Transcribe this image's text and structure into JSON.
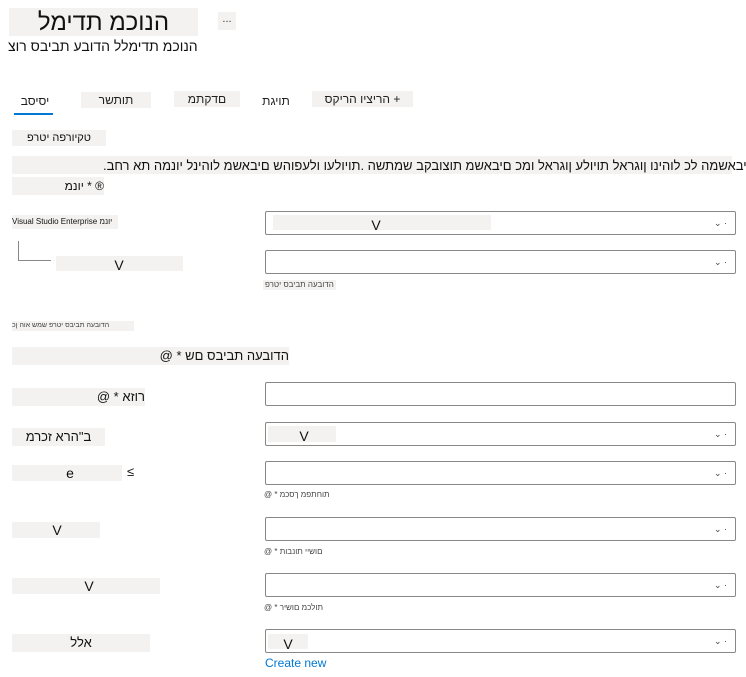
{
  "header": {
    "title": "הנוכמ תדימל",
    "more_label": "...",
    "subtitle": "הנוכמ תדימלל הדובע תביבס רוצ"
  },
  "tabs": [
    {
      "label": "יסיסב",
      "active": true
    },
    {
      "label": "תותשר"
    },
    {
      "label": "םדקתמ"
    },
    {
      "label": "תויגת"
    },
    {
      "label": "הריציו הריקס +"
    }
  ],
  "project": {
    "section_label": "טקיורפה יטרפ",
    "description": "רלש םיבאשמה לכ לוהינו ןוגראל תויולע ןוגראל ומכ םיבאשמ תוצובקב שמתשה .תויולעו ולעפוהש םיבאשמ לוהינל יונמה תא רחב.",
    "subscription_label": "יונמ * ®",
    "subscription_value": "Visual Studio Enterprise יונמ",
    "subscription_dropdown_value": "V",
    "subscription_chevron": "⌄ ·",
    "resource_group_value": "V",
    "resource_group_chevron": "⌄ ·",
    "resource_group_hint": "הדובעה תביבס יטרפ"
  },
  "instance": {
    "section_label": "הדובעה תביבס יטרפ שמש אוה ןכ",
    "workspace_name_label": "@ * הדובעה תביבס םש",
    "region_label": "@ * רוזא",
    "storage_label": "ב\"הרא זכרמ",
    "storage_value": "V",
    "storage_chevron": "⌄ ·",
    "key_vault_icon": "≤",
    "key_vault_value": "e",
    "key_vault_chevron": "⌄ ·",
    "key_vault_hint": "@ * תוחתפמ ךסכמ",
    "app_insights_value": "V",
    "app_insights_chevron": "⌄ ·",
    "app_insights_hint": "@ * םושיי תונבות",
    "container_registry_value": "V",
    "container_registry_chevron": "⌄ ·",
    "container_registry_hint": "@ * תולכמ םושיר",
    "last_label": "אלל",
    "last_value": "V",
    "last_chevron": "⌄ ·",
    "create_new_label": "Create new"
  }
}
